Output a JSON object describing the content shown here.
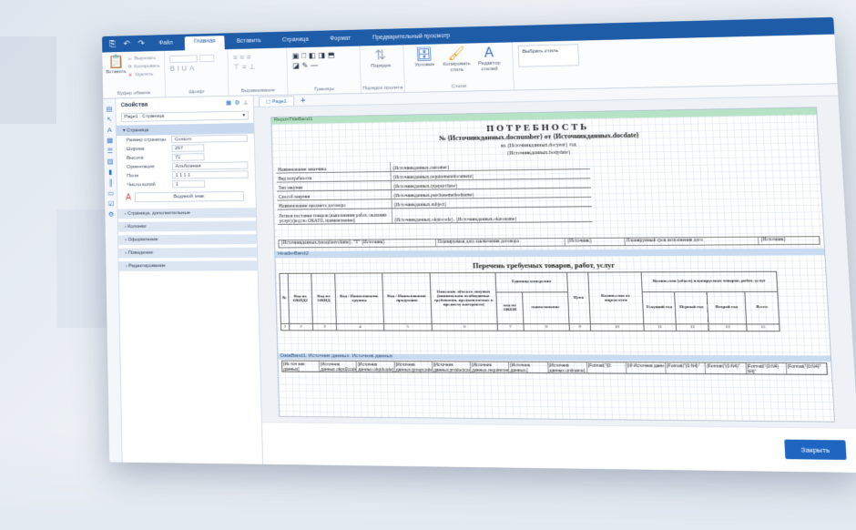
{
  "menu": {
    "quick_icons": [
      "⎘",
      "↶",
      "↷"
    ],
    "tabs": [
      "Файл",
      "Главная",
      "Вставить",
      "Страница",
      "Формат",
      "Предварительный просмотр"
    ],
    "active_tab": "Главная"
  },
  "ribbon": {
    "clipboard": {
      "paste": "Вставить",
      "cut": "Вырезать",
      "copy": "Копировать",
      "delete": "Удалить",
      "label": "Буфер обмена"
    },
    "font_label": "Шрифт",
    "align_label": "Выравнивание",
    "borders_label": "Границы",
    "tab_order": {
      "button": "Порядок",
      "label": "Порядок пролета"
    },
    "conditions": "Условия",
    "copy_style": "Копировать стиль",
    "style_editor": "Редактор стилей",
    "styles_label": "Стили",
    "select_style": "Выбрать стиль"
  },
  "properties": {
    "title": "Свойства",
    "selector": "Page1 : Страница",
    "category_open": "Страница",
    "rows": [
      {
        "key": "Размер страницы",
        "value": "Custom"
      },
      {
        "key": "Ширина",
        "value": "297"
      },
      {
        "key": "Высота",
        "value": "71"
      },
      {
        "key": "Ориентация",
        "value": "Альбомная"
      },
      {
        "key": "Поля",
        "value": "1  1  1  1"
      },
      {
        "key": "Число копий",
        "value": "1"
      }
    ],
    "text_label": "Водяной знак",
    "categories": [
      "Страница, дополнительные",
      "Колонки",
      "Оформление",
      "Поведение",
      "Редактирование"
    ]
  },
  "doc": {
    "tab": "Page1",
    "band_report_title": "ReportTitleBand1",
    "band_header": "HeaderBand2",
    "band_data": "DataBand1: Источник данных: Источник данных",
    "title": "ПОТРЕБНОСТЬ",
    "doc_no": "№ {Источникданных.docnumber} от {Источникданных.docdate}",
    "year_line": "на {Источникданных.docyear} год",
    "date_line": "{Источникданных.bodydate}",
    "info_rows": [
      {
        "k": "Наименование заказчика",
        "v": "{Источникданных.customer}"
      },
      {
        "k": "Вид потребности",
        "v": "{Источникданных.requirementdocument}"
      },
      {
        "k": "Тип закупки",
        "v": "{Источникданных.typepurchase}"
      },
      {
        "k": "Способ закупки",
        "v": "{Источникданных.purchasemethodname}"
      },
      {
        "k": "Наименование предмета договора",
        "v": "{Источникданных.subject}"
      },
      {
        "k": "Регион поставки товаров (выполнения работ, оказания услуг) (код по ОКАТО, наименование)",
        "v": "{Источникданных.okatocode}, {Источникданных.okatoname}"
      }
    ],
    "plan_row": [
      "{Источникданных.fyearplanvolume}, \"Т\"  {Источник}",
      "Планируемая дата заключения договора",
      "{Источник}",
      "Планируемый срок исполнения дого",
      "{Источник}"
    ],
    "subtitle": "Перечень требуемых товаров, работ, услуг",
    "headers": [
      "№",
      "Код по ОКПД2",
      "Код по ОКПД",
      "Код / Наименование группы",
      "Код / Наименование продукции",
      "Описание объекта закупки (минимально необходимые требования, предъявляемые к предмету контракта)",
      "Единица измерения",
      "Цена",
      "Количество не определено",
      "Количество (объем) планируемых товаров, работ, услуг"
    ],
    "unit_sub": [
      "код по ОКЕИ",
      "наименование"
    ],
    "qty_sub": [
      "Текущий год",
      "Первый год",
      "Второй год",
      "Всего"
    ],
    "numbers": [
      "1",
      "2",
      "3",
      "4",
      "5",
      "6",
      "7",
      "8",
      "9",
      "10",
      "11",
      "12",
      "13",
      "15"
    ],
    "data_cells": [
      "[Ис точ ник данных]",
      "[Источник данных.okpd2code]",
      "[Источник данных.okpdcode]",
      "[Источник данных.groupcode]",
      "[Источник данных.productcode]",
      "[Источник данных.requirement]",
      "[Источник данных.]",
      "[Источник данных.unitname]",
      "[Format(\"{0:",
      "[IIf Источник данн",
      "[Format(\"{0:N4}\"",
      "[Format(\"{0:N4}\"",
      "[Format(\"{0:N4} N4}\"",
      "[Format(\"{0:N4}\""
    ]
  },
  "close_button": "Закрыть"
}
